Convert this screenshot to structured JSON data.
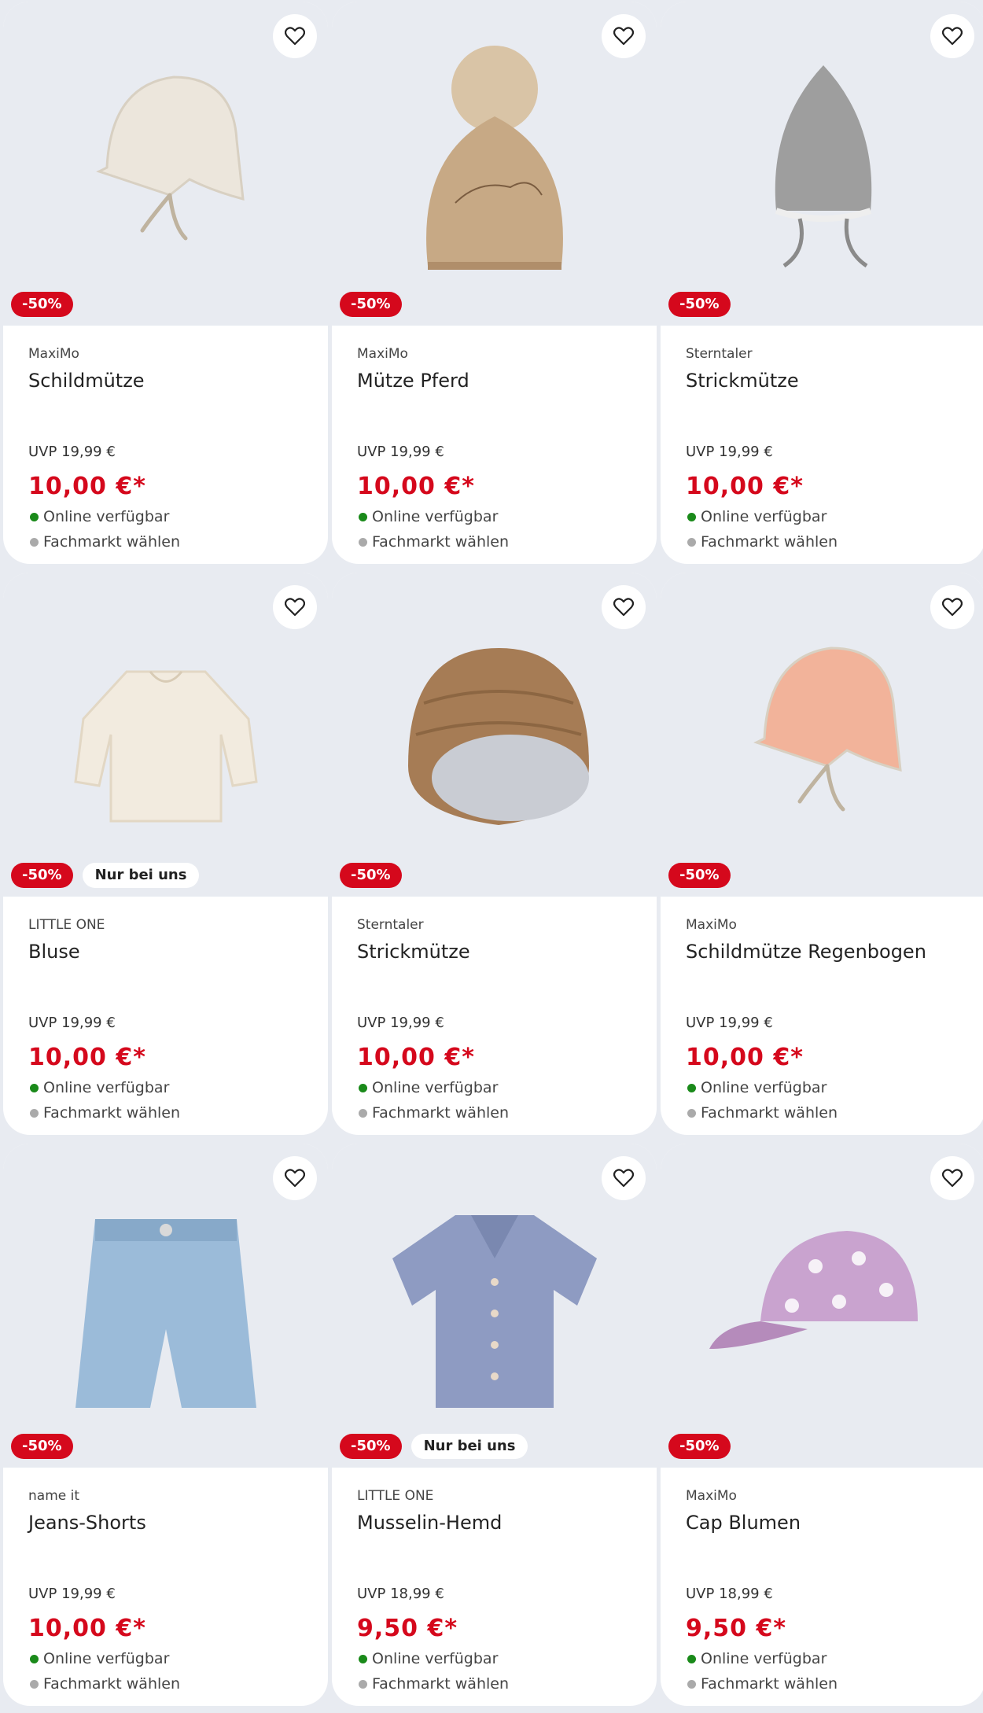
{
  "products": [
    {
      "brand": "MaxiMo",
      "name": "Schildmütze",
      "uvp": "UVP 19,99 €",
      "price": "10,00 €*",
      "discount": "-50%",
      "exclusive": "",
      "availability": "Online verfügbar",
      "store": "Fachmarkt wählen",
      "icon": "sun-hat-icon",
      "color": "#ece6dc"
    },
    {
      "brand": "MaxiMo",
      "name": "Mütze Pferd",
      "uvp": "UVP 19,99 €",
      "price": "10,00 €*",
      "discount": "-50%",
      "exclusive": "",
      "availability": "Online verfügbar",
      "store": "Fachmarkt wählen",
      "icon": "pompom-beanie-icon",
      "color": "#c7a985"
    },
    {
      "brand": "Sterntaler",
      "name": "Strickmütze",
      "uvp": "UVP 19,99 €",
      "price": "10,00 €*",
      "discount": "-50%",
      "exclusive": "",
      "availability": "Online verfügbar",
      "store": "Fachmarkt wählen",
      "icon": "knit-hat-icon",
      "color": "#9e9e9e"
    },
    {
      "brand": "LITTLE ONE",
      "name": "Bluse",
      "uvp": "UVP 19,99 €",
      "price": "10,00 €*",
      "discount": "-50%",
      "exclusive": "Nur bei uns",
      "availability": "Online verfügbar",
      "store": "Fachmarkt wählen",
      "icon": "blouse-icon",
      "color": "#f2ebdf"
    },
    {
      "brand": "Sterntaler",
      "name": "Strickmütze",
      "uvp": "UVP 19,99 €",
      "price": "10,00 €*",
      "discount": "-50%",
      "exclusive": "",
      "availability": "Online verfügbar",
      "store": "Fachmarkt wählen",
      "icon": "knit-beanie-icon",
      "color": "#a67c55"
    },
    {
      "brand": "MaxiMo",
      "name": "Schildmütze Regenbogen",
      "uvp": "UVP 19,99 €",
      "price": "10,00 €*",
      "discount": "-50%",
      "exclusive": "",
      "availability": "Online verfügbar",
      "store": "Fachmarkt wählen",
      "icon": "sun-hat-icon",
      "color": "#f2b39a"
    },
    {
      "brand": "name it",
      "name": "Jeans-Shorts",
      "uvp": "UVP 19,99 €",
      "price": "10,00 €*",
      "discount": "-50%",
      "exclusive": "",
      "availability": "Online verfügbar",
      "store": "Fachmarkt wählen",
      "icon": "shorts-icon",
      "color": "#9bbbd9"
    },
    {
      "brand": "LITTLE ONE",
      "name": "Musselin-Hemd",
      "uvp": "UVP 18,99 €",
      "price": "9,50 €*",
      "discount": "-50%",
      "exclusive": "Nur bei uns",
      "availability": "Online verfügbar",
      "store": "Fachmarkt wählen",
      "icon": "shirt-icon",
      "color": "#8e9bc2"
    },
    {
      "brand": "MaxiMo",
      "name": "Cap Blumen",
      "uvp": "UVP 18,99 €",
      "price": "9,50 €*",
      "discount": "-50%",
      "exclusive": "",
      "availability": "Online verfügbar",
      "store": "Fachmarkt wählen",
      "icon": "cap-icon",
      "color": "#c9a3cf"
    }
  ],
  "colors": {
    "accent": "#d5081c",
    "available": "#1a8a1a",
    "muted": "#aaaaaa",
    "image_bg": "#e8ebf1"
  }
}
